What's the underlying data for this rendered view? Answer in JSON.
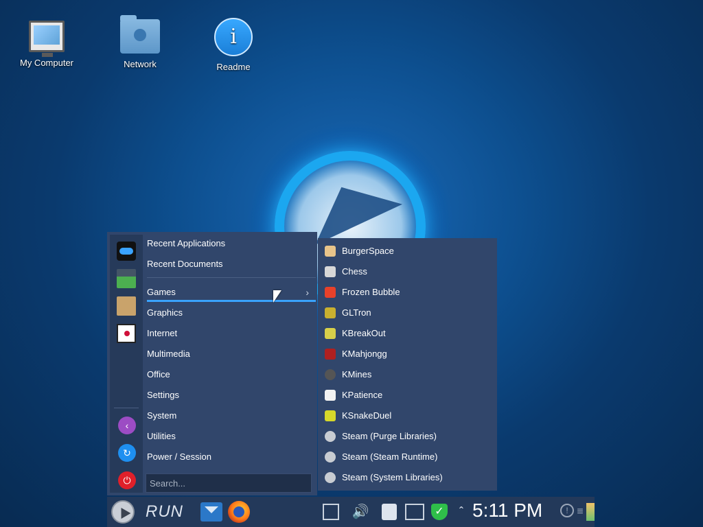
{
  "desktop": {
    "icons": [
      {
        "label": "My Computer"
      },
      {
        "label": "Network"
      },
      {
        "label": "Readme"
      }
    ]
  },
  "menu": {
    "categories": [
      {
        "label": "Recent Applications"
      },
      {
        "label": "Recent Documents"
      },
      {
        "label": "Games"
      },
      {
        "label": "Graphics"
      },
      {
        "label": "Internet"
      },
      {
        "label": "Multimedia"
      },
      {
        "label": "Office"
      },
      {
        "label": "Settings"
      },
      {
        "label": "System"
      },
      {
        "label": "Utilities"
      },
      {
        "label": "Power / Session"
      }
    ],
    "search_placeholder": "Search...",
    "active_category": "Games"
  },
  "submenu": {
    "items": [
      {
        "label": "BurgerSpace",
        "icon": "burgerspace-icon",
        "color": "#e8c48a"
      },
      {
        "label": "Chess",
        "icon": "chess-icon",
        "color": "#d8d8d8"
      },
      {
        "label": "Frozen Bubble",
        "icon": "frozen-bubble-icon",
        "color": "#e8412a"
      },
      {
        "label": "GLTron",
        "icon": "gltron-icon",
        "color": "#c9b030"
      },
      {
        "label": "KBreakOut",
        "icon": "kbreakout-icon",
        "color": "#d8d04a"
      },
      {
        "label": "KMahjongg",
        "icon": "kmahjongg-icon",
        "color": "#b02020"
      },
      {
        "label": "KMines",
        "icon": "kmines-icon",
        "color": "#555555"
      },
      {
        "label": "KPatience",
        "icon": "kpatience-icon",
        "color": "#f2f2f2"
      },
      {
        "label": "KSnakeDuel",
        "icon": "ksnakeduel-icon",
        "color": "#d6d82a"
      },
      {
        "label": "Steam (Purge Libraries)",
        "icon": "steam-icon",
        "color": "#c8ccd2"
      },
      {
        "label": "Steam (Steam Runtime)",
        "icon": "steam-icon",
        "color": "#c8ccd2"
      },
      {
        "label": "Steam (System Libraries)",
        "icon": "steam-icon",
        "color": "#c8ccd2"
      }
    ]
  },
  "taskbar": {
    "run_label": "RUN",
    "clock": "5:11 PM"
  }
}
